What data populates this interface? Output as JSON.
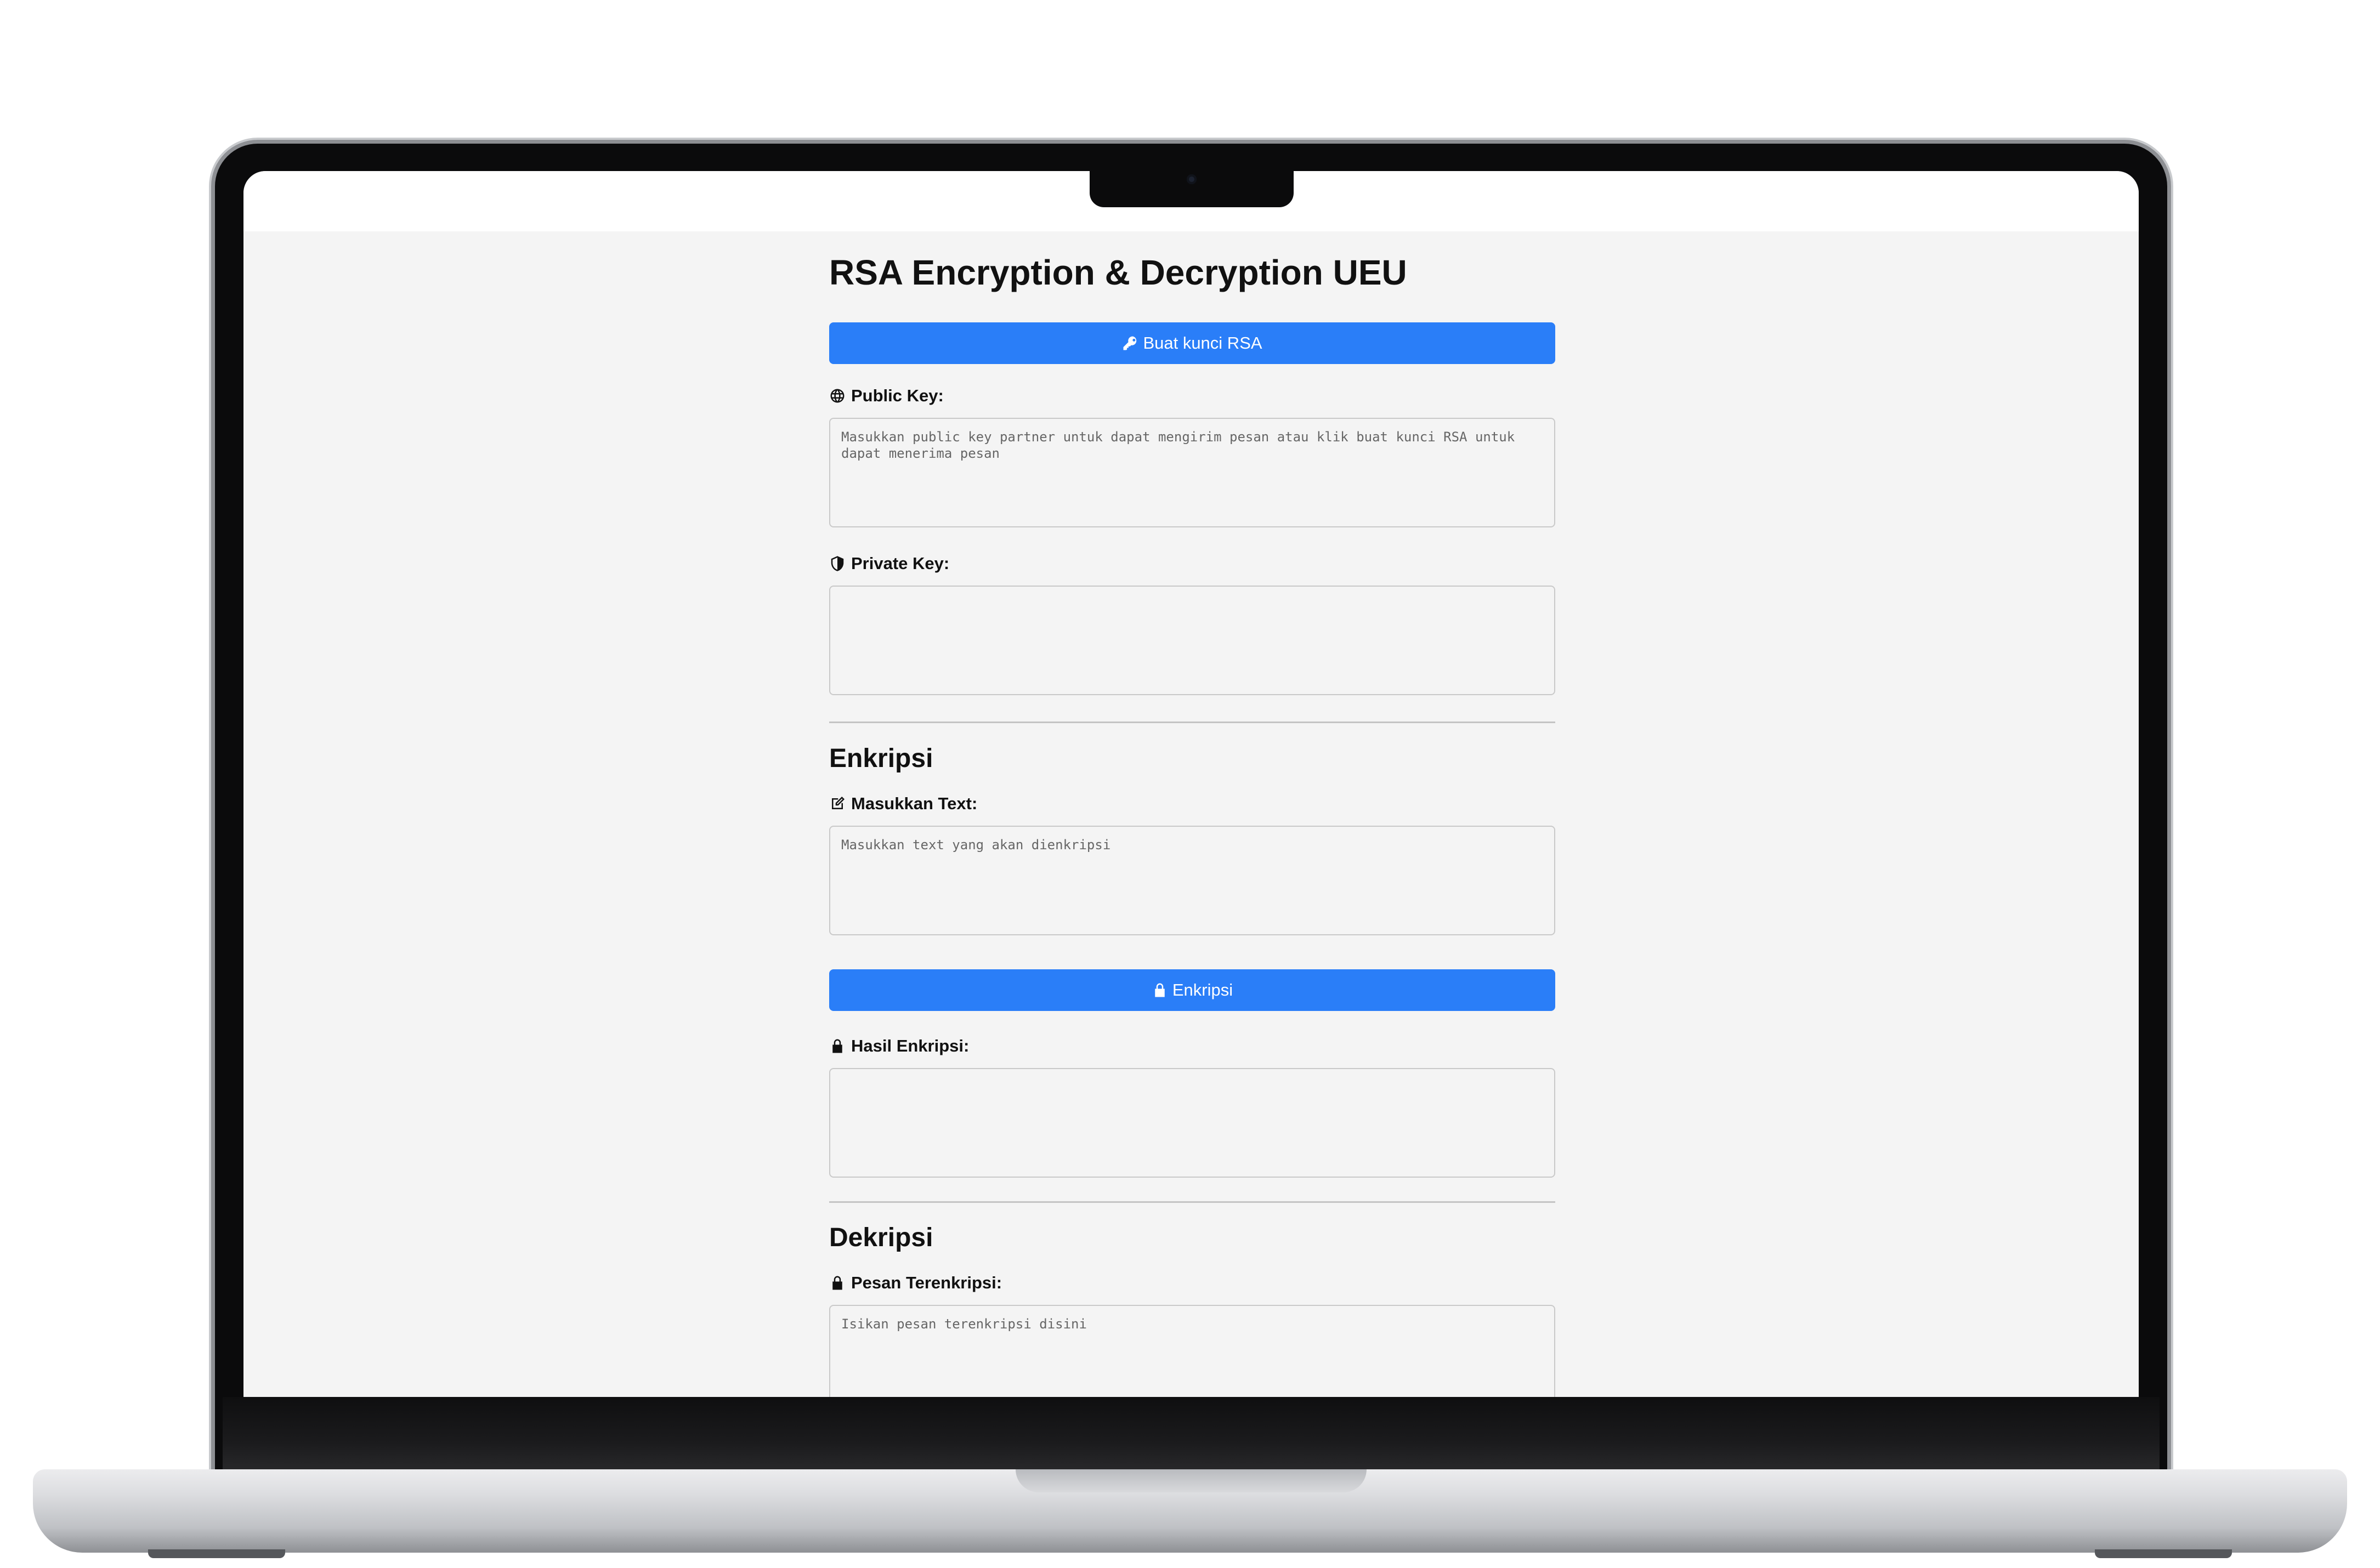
{
  "page": {
    "title": "RSA Encryption & Decryption UEU",
    "generate_button": {
      "label": "Buat kunci RSA",
      "icon": "key-icon"
    },
    "public_key": {
      "label": "Public Key:",
      "icon": "globe-icon",
      "placeholder": "Masukkan public key partner untuk dapat mengirim pesan atau klik buat kunci RSA untuk dapat menerima pesan",
      "value": ""
    },
    "private_key": {
      "label": "Private Key:",
      "icon": "shield-icon",
      "placeholder": "",
      "value": ""
    },
    "encrypt_section": {
      "heading": "Enkripsi",
      "input_label": "Masukkan Text:",
      "input_icon": "edit-icon",
      "input_placeholder": "Masukkan text yang akan dienkripsi",
      "button_label": "Enkripsi",
      "button_icon": "lock-icon",
      "result_label": "Hasil Enkripsi:",
      "result_icon": "lock-icon",
      "result_value": ""
    },
    "decrypt_section": {
      "heading": "Dekripsi",
      "input_label": "Pesan Terenkripsi:",
      "input_icon": "lock-icon",
      "input_placeholder": "Isikan pesan terenkripsi disini"
    }
  },
  "colors": {
    "primary_button": "#2a7ef8",
    "page_background": "#f4f4f4",
    "text": "#111111",
    "laptop_frame": "#0b0b0c"
  }
}
